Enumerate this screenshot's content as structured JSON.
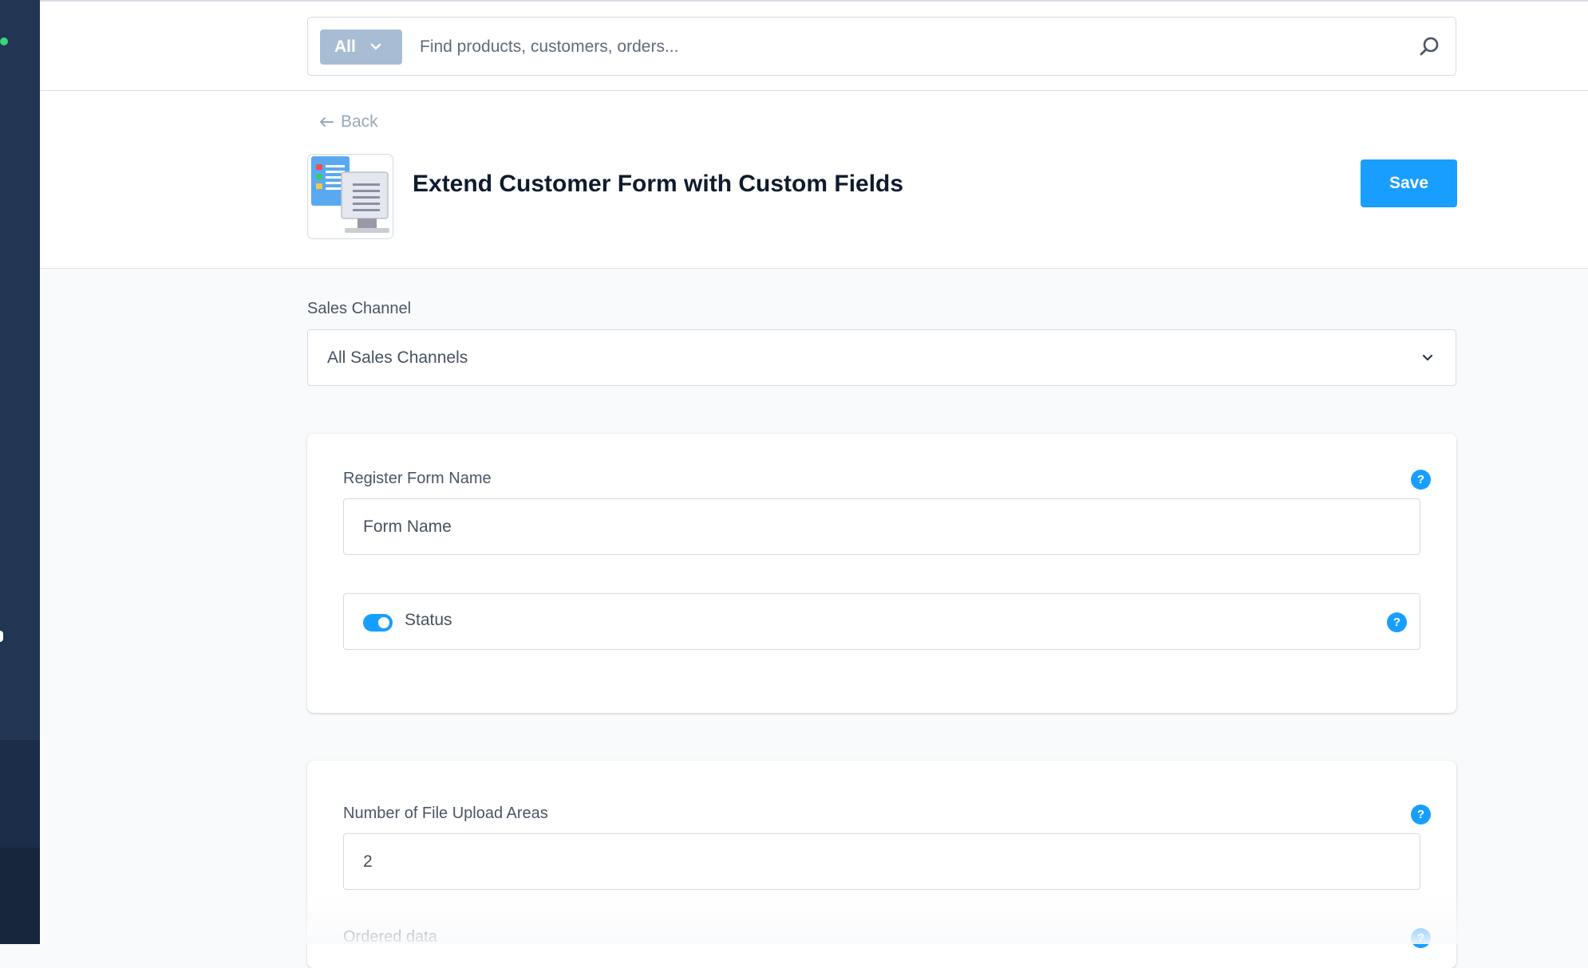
{
  "search": {
    "filter_label": "All",
    "placeholder": "Find products, customers, orders..."
  },
  "header": {
    "back_label": "Back",
    "title": "Extend Customer Form with Custom Fields",
    "save_label": "Save"
  },
  "sales_channel": {
    "label": "Sales Channel",
    "value": "All Sales Channels"
  },
  "register_card": {
    "form_name_label": "Register Form Name",
    "form_name_placeholder": "Form Name",
    "status_label": "Status",
    "status_enabled": true
  },
  "upload_card": {
    "file_areas_label": "Number of File Upload Areas",
    "file_areas_value": "2",
    "ordered_data_label": "Ordered data"
  },
  "help_glyph": "?",
  "colors": {
    "accent": "#189eff",
    "sidebar": "#223552",
    "filter_button": "#a8bdd4"
  }
}
